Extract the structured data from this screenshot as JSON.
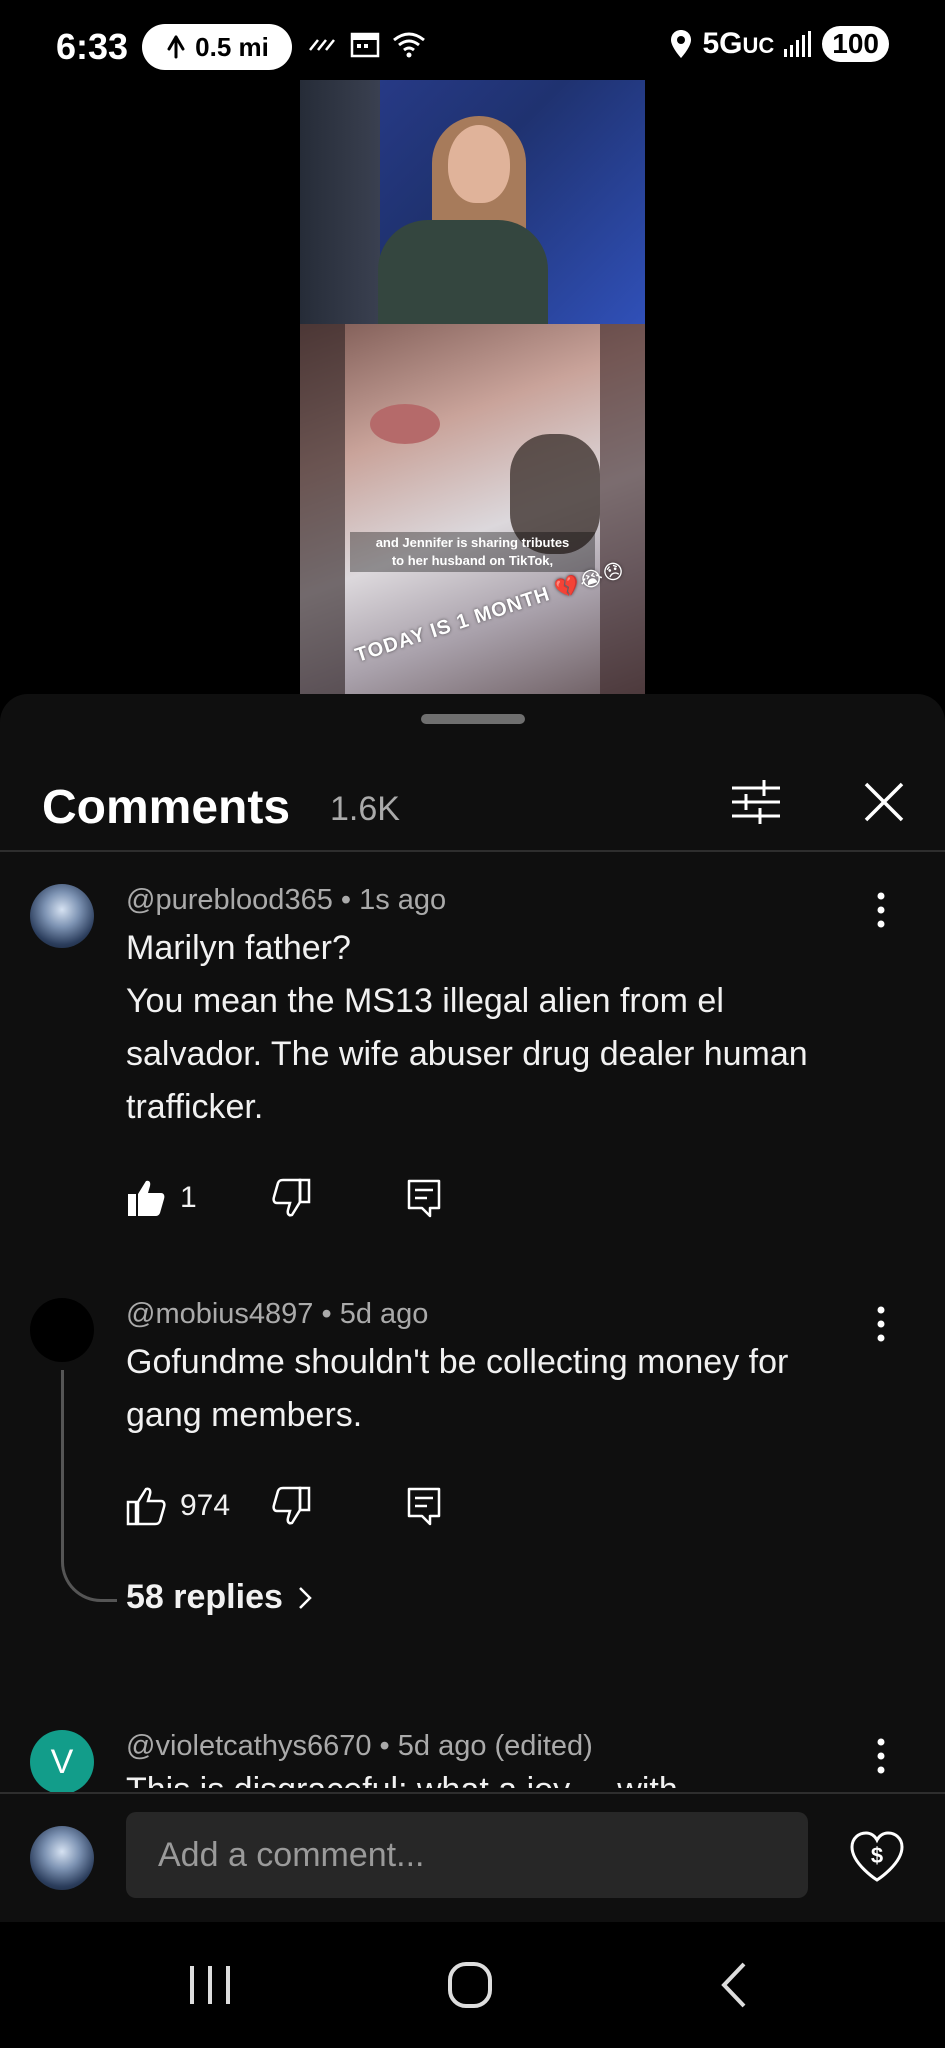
{
  "status_bar": {
    "time": "6:33",
    "nav_distance": "0.5 mi",
    "network": "5G",
    "network_suffix": "UC",
    "battery": "100"
  },
  "video": {
    "caption_line1": "and Jennifer is sharing tributes",
    "caption_line2": "to her husband on TikTok,",
    "overlay_text": "TODAY IS 1 MONTH 💔😭😞"
  },
  "comments_panel": {
    "title": "Comments",
    "count": "1.6K",
    "comments": [
      {
        "author": "@pureblood365",
        "time": "1s ago",
        "lines": [
          "Marilyn father?",
          "You mean the MS13 illegal alien from el",
          "salvador. The wife abuser drug dealer human",
          "trafficker."
        ],
        "likes": "1"
      },
      {
        "author": "@mobius4897",
        "time": "5d ago",
        "lines": [
          "Gofundme shouldn't be collecting money for",
          "gang members."
        ],
        "likes": "974",
        "replies_label": "58 replies"
      },
      {
        "author": "@violetcathys6670",
        "time": "5d ago (edited)",
        "avatar_letter": "V",
        "partial_text": "This is disgraceful: what a joy ... with ..."
      }
    ],
    "compose_placeholder": "Add a comment..."
  },
  "colors": {
    "sheet_bg": "#0f0f0f",
    "secondary_text": "#aaaaaa",
    "avatar_v": "#129d8a"
  }
}
